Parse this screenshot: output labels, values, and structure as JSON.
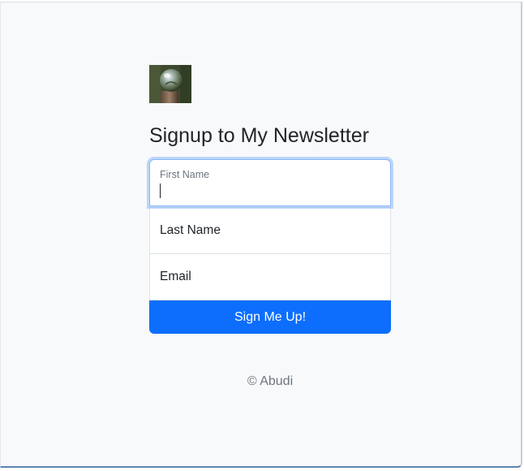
{
  "form": {
    "title": "Signup to My Newsletter",
    "first_name": {
      "label": "First Name",
      "value": ""
    },
    "last_name": {
      "placeholder": "Last Name"
    },
    "email": {
      "placeholder": "Email"
    },
    "submit_label": "Sign Me Up!"
  },
  "footer": {
    "copyright": "© Abudi"
  },
  "colors": {
    "primary": "#0d6efd",
    "background": "#f8f9fa",
    "focus_ring": "#86b7fe",
    "text": "#212529",
    "muted": "#6c757d"
  },
  "icons": {
    "logo": "crystal-ball-photo"
  }
}
